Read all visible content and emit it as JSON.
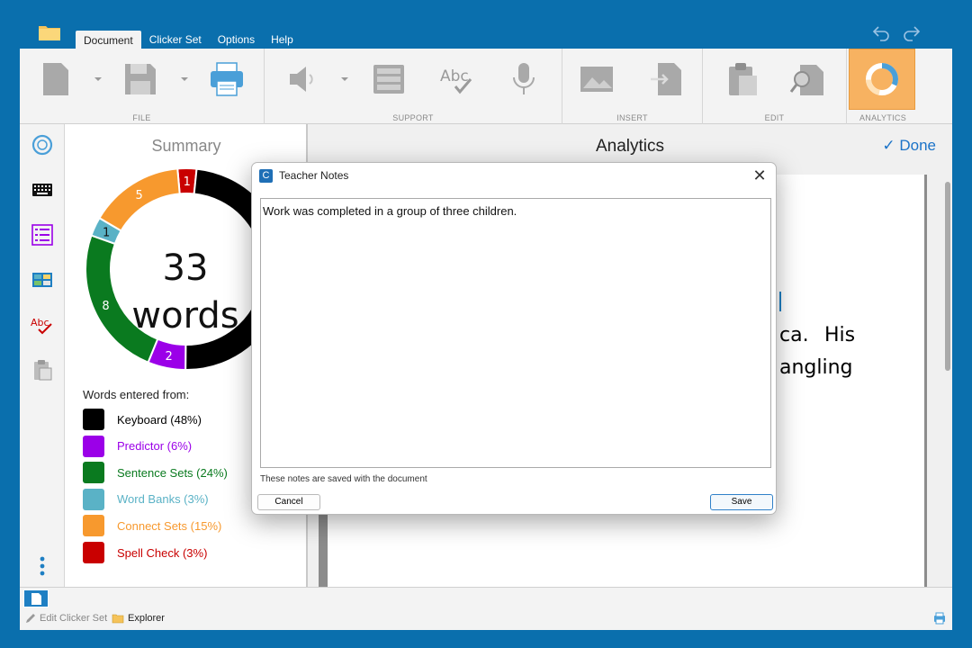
{
  "menu": {
    "items": [
      "Document",
      "Clicker Set",
      "Options",
      "Help"
    ],
    "active": "Document"
  },
  "ribbon": {
    "groups": [
      {
        "label": "FILE"
      },
      {
        "label": "SUPPORT"
      },
      {
        "label": "INSERT"
      },
      {
        "label": "EDIT"
      },
      {
        "label": "ANALYTICS"
      }
    ],
    "accent_color": "#f7b261"
  },
  "summary": {
    "title": "Summary",
    "total_count": "33",
    "total_unit": "words",
    "legend_title": "Words entered from:",
    "legend": [
      {
        "label": "Keyboard (48%)",
        "color": "#000000"
      },
      {
        "label": "Predictor (6%)",
        "color": "#9b00e8"
      },
      {
        "label": "Sentence Sets (24%)",
        "color": "#0a7a1f"
      },
      {
        "label": "Word Banks (3%)",
        "color": "#5ab2c6"
      },
      {
        "label": "Connect Sets (15%)",
        "color": "#f7992e"
      },
      {
        "label": "Spell Check (3%)",
        "color": "#c90000"
      }
    ]
  },
  "chart_data": {
    "type": "pie",
    "categories": [
      "Keyboard",
      "Predictor",
      "Sentence Sets",
      "Word Banks",
      "Connect Sets",
      "Spell Check"
    ],
    "values": [
      16,
      2,
      8,
      1,
      5,
      1
    ],
    "data_labels": [
      "",
      "2",
      "8",
      "1",
      "5",
      "1"
    ],
    "colors": [
      "#000000",
      "#9b00e8",
      "#0a7a1f",
      "#5ab2c6",
      "#f7992e",
      "#c90000"
    ]
  },
  "analytics": {
    "title": "Analytics",
    "done_label": "✓ Done",
    "doc_fragments": [
      {
        "text": "ca.",
        "color": "#f7992e"
      },
      {
        "text": "His",
        "color": "#111111"
      },
      {
        "text": "angling",
        "color": "#c90000"
      }
    ]
  },
  "statusbar": {
    "edit_clicker_set": "Edit Clicker Set",
    "explorer": "Explorer"
  },
  "dialog": {
    "title": "Teacher Notes",
    "icon_letter": "C",
    "notes_text": "Work was completed in a group of three children.",
    "hint": "These notes are saved with the document",
    "cancel_label": "Cancel",
    "save_label": "Save"
  }
}
